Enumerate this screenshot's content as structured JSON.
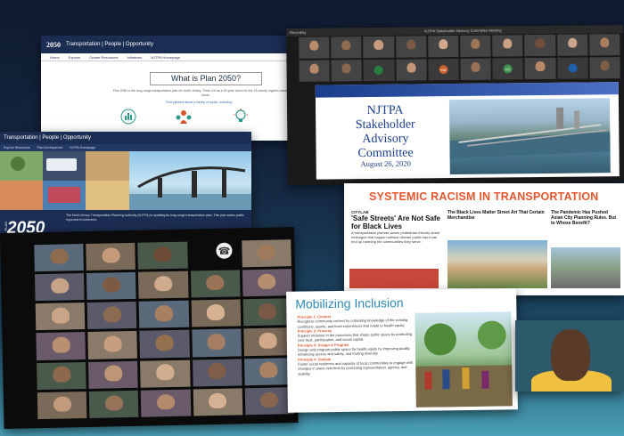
{
  "plan_site": {
    "logo": "2050",
    "tagline": "Transportation | People | Opportunity",
    "nav": [
      "Home",
      "Explore",
      "Create Resources",
      "Initiatives",
      "NJTPA Homepage"
    ],
    "heading": "What is Plan 2050?",
    "paragraph": "Plan 2050 is the long-range transportation plan for North Jersey. Think of it as a 30-year vision for the 13-county region's transportation future.",
    "link": "Find planned about a variety of topics, including:"
  },
  "plan_hero": {
    "tagline": "Transportation | People | Opportunity",
    "nav": [
      "Explore Resources",
      "Plan Development",
      "NJTPA Homepage"
    ],
    "big_title": "2050",
    "vertical_label": "PLAN",
    "blurb": "The North Jersey Transportation Planning Authority (NJTPA) is updating its long-range transportation plan. This plan seeks public input and involvement."
  },
  "njtpa_zoom": {
    "window_title": "NJTPA Stakeholder Advisory Committee Meeting",
    "recording": "Recording",
    "participants": [
      {
        "kind": "video",
        "color": "#b98a6a"
      },
      {
        "kind": "video",
        "color": "#8f6b4f"
      },
      {
        "kind": "video",
        "color": "#c79b7e"
      },
      {
        "kind": "video",
        "color": "#7a5a44"
      },
      {
        "kind": "video",
        "color": "#d1a98a"
      },
      {
        "kind": "video",
        "color": "#9c7456"
      },
      {
        "kind": "video",
        "color": "#caa082"
      },
      {
        "kind": "video",
        "color": "#6f4e3a"
      },
      {
        "kind": "video",
        "color": "#c8a48c"
      },
      {
        "kind": "video",
        "color": "#a77e5f"
      },
      {
        "kind": "video",
        "color": "#b6876a"
      },
      {
        "kind": "video",
        "color": "#8a6850"
      },
      {
        "kind": "initials",
        "initials": "",
        "color": "#2a7f3f"
      },
      {
        "kind": "video",
        "color": "#c59576"
      },
      {
        "kind": "initials",
        "initials": "KM",
        "color": "#c8622c"
      },
      {
        "kind": "video",
        "color": "#9a7154"
      },
      {
        "kind": "initials",
        "initials": "KS",
        "color": "#3f8f4f"
      },
      {
        "kind": "video",
        "color": "#b98a6a"
      },
      {
        "kind": "initials",
        "initials": "",
        "color": "#1f5fa8"
      },
      {
        "kind": "video",
        "color": "#7f5f47"
      }
    ],
    "slide": {
      "title_lines": [
        "NJTPA",
        "Stakeholder",
        "Advisory",
        "Committee"
      ],
      "date": "August 26, 2020"
    }
  },
  "racism_slide": {
    "title": "SYSTEMIC RACISM IN TRANSPORTATION",
    "col1_source": "CITYLAB",
    "col1_headline": "'Safe Streets' Are Not Safe for Black Lives",
    "col1_body": "A transportation planner warns pedestrian-friendly street redesigns that happen without diverse public input can end up harming the communities they serve.",
    "col2_headline": "The Black Lives Matter Street Art That Certain Merchandise",
    "col3_headline": "The Pandemic Has Pushed Asian City Planning Rules. But to Whose Benefit?"
  },
  "gallery": {
    "tiles": [
      "#8f6b4f",
      "#c49a7a",
      "#6b4a36",
      "#b58a6b",
      "#a07a5c",
      "#c7a487",
      "#7d5a44",
      "#d0aa8c",
      "#9a7357",
      "#b48e6f",
      "#caa487",
      "#8b6a52",
      "#a9805f",
      "#d6b292",
      "#7a5946",
      "#b88f70",
      "#c69e80",
      "#94704f",
      "#a57d62",
      "#cfa988",
      "#8c684d",
      "#bd9577",
      "#d2ae90",
      "#7e5e48",
      "#a98163",
      "#c29b7d",
      "#96745a",
      "#b28a6c",
      "#d4b094",
      "#88664f"
    ]
  },
  "mobilizing": {
    "title": "Mobilizing Inclusion",
    "principles": [
      {
        "heading": "Principle 1: Context",
        "text": "Recognize community context by cultivating knowledge of the existing conditions, assets, and lived experiences that relate to health equity."
      },
      {
        "heading": "Principle 2: Process",
        "text": "Support inclusion in the processes that shape public space by promoting civic trust, participation, and social capital."
      },
      {
        "heading": "Principle 3: Design & Program",
        "text": "Design and program public space for health equity by improving quality, enhancing access and safety, and inviting diversity."
      },
      {
        "heading": "Principle 4: Sustain",
        "text": "Foster social resilience and capacity of local communities to engage with changes in place over time by promoting representation, agency, and stability."
      }
    ]
  },
  "speaker": {
    "label": ""
  },
  "colors": {
    "accent_orange": "#e4572e",
    "njtpa_blue": "#1a3e8c",
    "inclusion_blue": "#2f8bb5"
  }
}
